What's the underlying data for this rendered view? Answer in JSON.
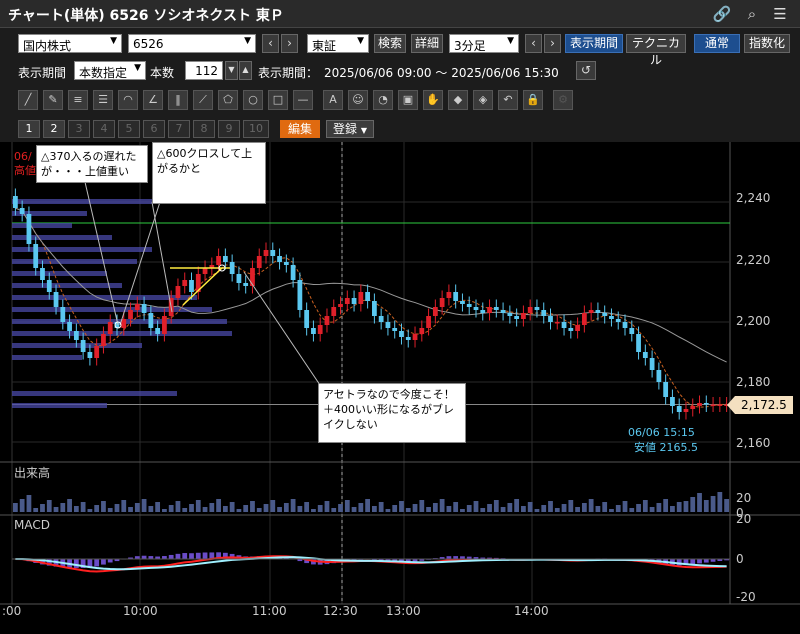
{
  "window": {
    "title": "チャート(単体) 6526 ソシオネクスト 東Ｐ"
  },
  "toolbar": {
    "market_select": "国内株式",
    "code_input": "6526",
    "exchange_select": "東証",
    "search_label": "検索",
    "detail_label": "詳細",
    "interval_select": "3分足",
    "display_period_label": "表示期間",
    "technical_label": "テクニカル",
    "normal_label": "通常",
    "index_label": "指数化",
    "period_label": "表示期間",
    "count_mode_select": "本数指定",
    "count_label": "本数",
    "count_value": "112",
    "period_range": "表示期間：　2025/06/06 09:00 〜 2025/06/06 15:30",
    "edit_label": "編集",
    "register_label": "登録"
  },
  "pages": [
    "1",
    "2",
    "3",
    "4",
    "5",
    "6",
    "7",
    "8",
    "9",
    "10"
  ],
  "chart": {
    "notes": [
      "△370入るの遅れたが・・・上値重い",
      "△600クロスして上がるかと",
      "アセトラなので今度こそ！＋400いい形になるがブレイクしない"
    ],
    "corner_date": "06/",
    "corner_label": "高値",
    "price_badge": "2,172.5",
    "last_time": "06/06 15:15",
    "low_label": "安値 2165.5",
    "volume_title": "出来高",
    "macd_title": "MACD",
    "price_ticks": [
      "2,240",
      "2,220",
      "2,200",
      "2,180",
      "2,160"
    ],
    "volume_ticks": [
      "20",
      "0"
    ],
    "macd_ticks": [
      "20",
      "0",
      "-20"
    ],
    "time_ticks": [
      ":00",
      "10:00",
      "11:00",
      "12:30",
      "13:00",
      "14:00"
    ],
    "colors": {
      "up": "#e0202a",
      "down": "#5bc8f0",
      "resistance": "#2ecc40",
      "macd": "#ff2020",
      "signal": "#a0f0ff",
      "histogram": "#6a4cc8"
    }
  },
  "chart_data": {
    "type": "candlestick",
    "x": [
      "09:00",
      "09:03",
      "09:06",
      "09:09",
      "09:12",
      "09:15",
      "09:18",
      "09:21",
      "09:24",
      "09:27",
      "09:30",
      "09:33",
      "09:36",
      "09:39",
      "09:42",
      "09:45",
      "09:48",
      "09:51",
      "09:54",
      "09:57",
      "10:00",
      "10:03",
      "10:06",
      "10:09",
      "10:12",
      "10:15",
      "10:18",
      "10:21",
      "10:24",
      "10:27",
      "10:30",
      "10:33",
      "10:36",
      "10:39",
      "10:42",
      "10:45",
      "10:48",
      "10:51",
      "10:54",
      "10:57",
      "11:00",
      "11:03",
      "11:06",
      "11:09",
      "11:12",
      "11:15",
      "11:18",
      "11:21",
      "11:24",
      "11:27",
      "12:30",
      "12:33",
      "12:36",
      "12:39",
      "12:42",
      "12:45",
      "12:48",
      "12:51",
      "12:54",
      "12:57",
      "13:00",
      "13:03",
      "13:06",
      "13:09",
      "13:12",
      "13:15",
      "13:18",
      "13:21",
      "13:24",
      "13:27",
      "13:30",
      "13:33",
      "13:36",
      "13:39",
      "13:42",
      "13:45",
      "13:48",
      "13:51",
      "13:54",
      "13:57",
      "14:00",
      "14:03",
      "14:06",
      "14:09",
      "14:12",
      "14:15",
      "14:18",
      "14:21",
      "14:24",
      "14:27",
      "14:30",
      "14:33",
      "14:36",
      "14:39",
      "14:42",
      "14:45",
      "14:48",
      "14:51",
      "14:54",
      "14:57",
      "15:00",
      "15:03",
      "15:06",
      "15:09",
      "15:12",
      "15:15"
    ],
    "close": [
      2238,
      2236,
      2226,
      2218,
      2214,
      2210,
      2205,
      2200,
      2197,
      2194,
      2190,
      2188,
      2192,
      2196,
      2200,
      2198,
      2201,
      2204,
      2206,
      2203,
      2198,
      2196,
      2202,
      2208,
      2212,
      2214,
      2210,
      2216,
      2218,
      2219,
      2222,
      2220,
      2216,
      2213,
      2212,
      2218,
      2222,
      2224,
      2222,
      2220,
      2219,
      2214,
      2204,
      2198,
      2196,
      2199,
      2202,
      2205,
      2206,
      2208,
      2206,
      2210,
      2207,
      2202,
      2200,
      2198,
      2197,
      2195,
      2194,
      2196,
      2198,
      2202,
      2205,
      2208,
      2210,
      2207,
      2206,
      2205,
      2204,
      2203,
      2205,
      2204,
      2203,
      2202,
      2201,
      2203,
      2205,
      2204,
      2202,
      2200,
      2200,
      2198,
      2197,
      2199,
      2203,
      2204,
      2203,
      2202,
      2201,
      2200,
      2198,
      2196,
      2190,
      2188,
      2184,
      2180,
      2175,
      2172,
      2170,
      2171,
      2172,
      2173,
      2172.5,
      2172.5,
      2172.5,
      2172.5
    ],
    "macd_ylim": [
      -20,
      20
    ],
    "price_ylim": [
      2155,
      2250
    ],
    "resistance": 2233
  }
}
